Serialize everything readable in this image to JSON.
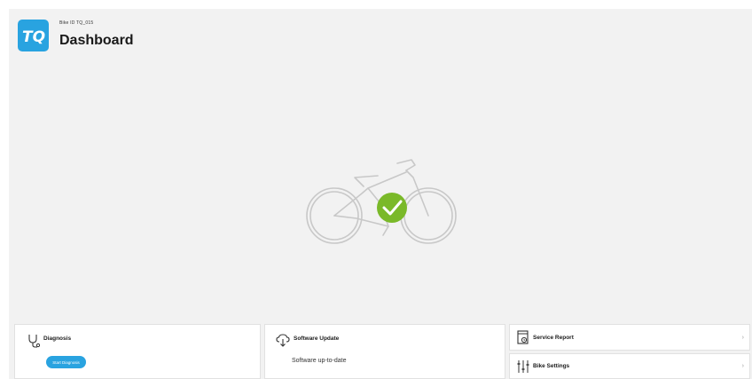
{
  "header": {
    "logo_text": "TQ",
    "bike_id_label": "Bike ID",
    "bike_id_value": "TQ_015",
    "title": "Dashboard"
  },
  "status": {
    "state": "ok",
    "check_color": "#7ab929"
  },
  "cards": {
    "diagnosis": {
      "title": "Diagnosis",
      "button_label": "Start Diagnosis",
      "icon": "stethoscope-icon"
    },
    "software_update": {
      "title": "Software Update",
      "status_text": "Software up-to-date",
      "icon": "cloud-download-icon"
    },
    "service_report": {
      "title": "Service Report",
      "icon": "report-icon",
      "chevron": "›"
    },
    "bike_settings": {
      "title": "Bike Settings",
      "icon": "sliders-icon",
      "chevron": "›"
    }
  },
  "colors": {
    "accent": "#29a3e0",
    "background": "#f2f2f2",
    "success": "#7ab929"
  }
}
